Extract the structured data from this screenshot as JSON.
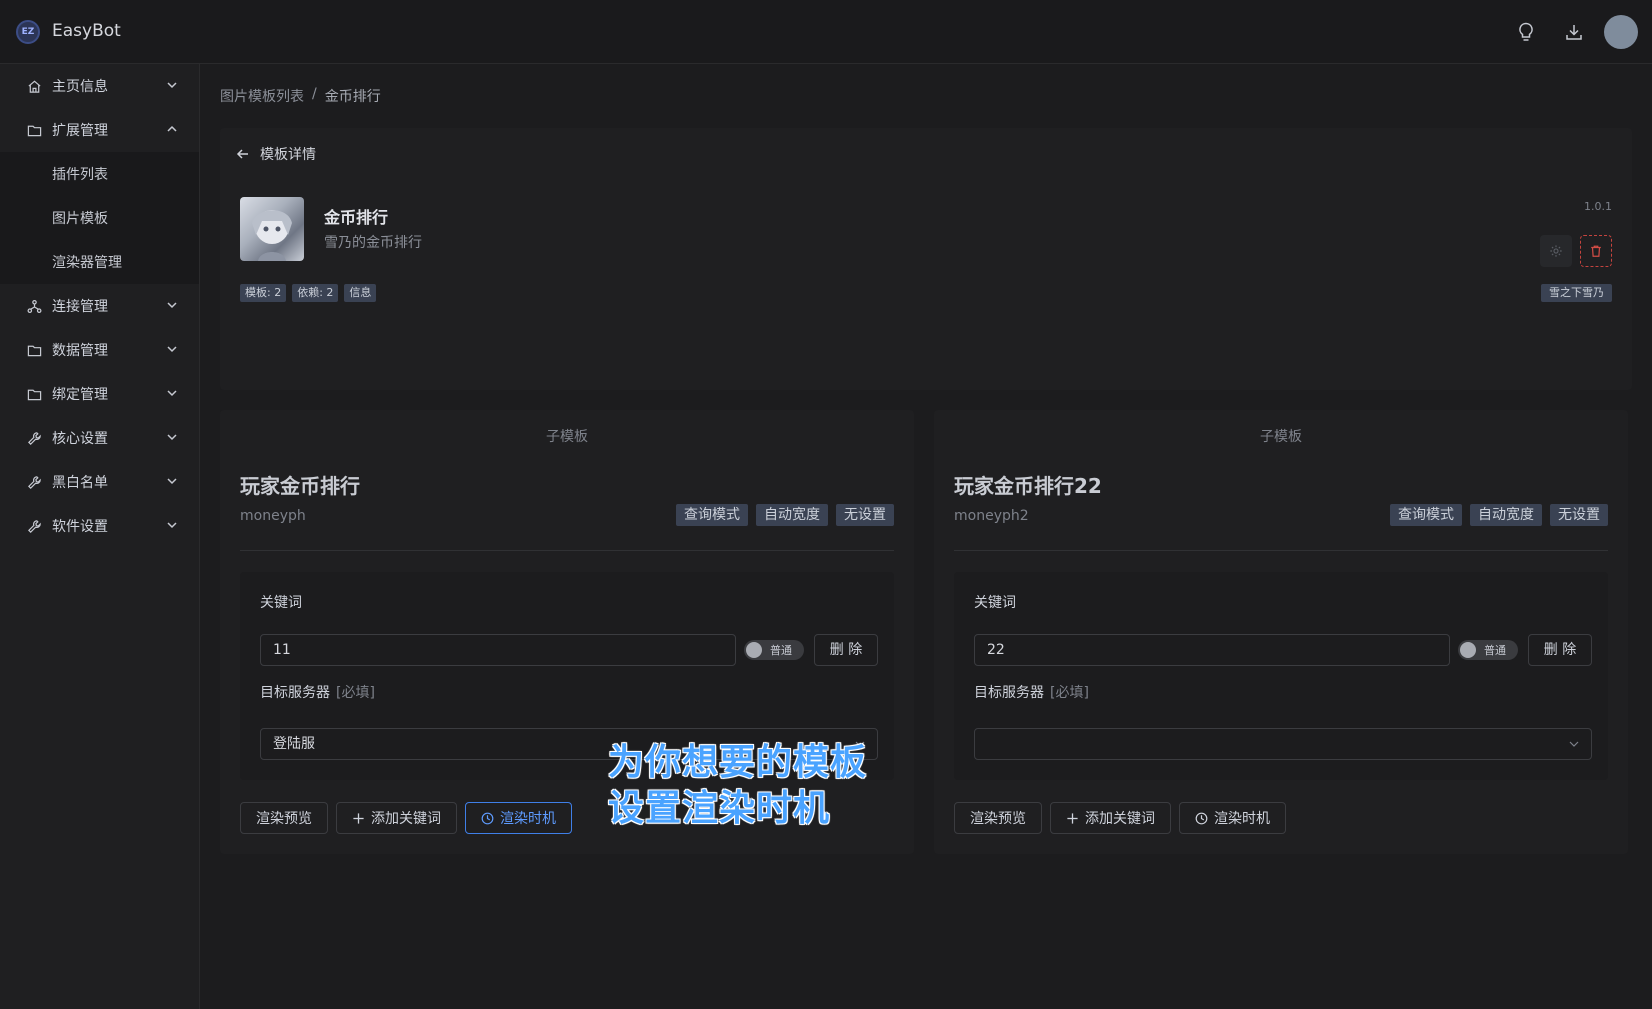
{
  "app": {
    "logo_text": "EZ",
    "title": "EasyBot"
  },
  "topbar": {
    "icons": [
      "lightbulb-icon",
      "download-icon"
    ]
  },
  "sidebar": {
    "items": [
      {
        "label": "主页信息",
        "icon": "home-icon"
      },
      {
        "label": "扩展管理",
        "icon": "folder-icon",
        "expanded": true,
        "children": [
          {
            "label": "插件列表"
          },
          {
            "label": "图片模板"
          },
          {
            "label": "渲染器管理"
          }
        ]
      },
      {
        "label": "连接管理",
        "icon": "network-icon"
      },
      {
        "label": "数据管理",
        "icon": "folder-icon"
      },
      {
        "label": "绑定管理",
        "icon": "folder-icon"
      },
      {
        "label": "核心设置",
        "icon": "wrench-icon"
      },
      {
        "label": "黑白名单",
        "icon": "wrench-icon"
      },
      {
        "label": "软件设置",
        "icon": "wrench-icon"
      }
    ]
  },
  "breadcrumb": {
    "parent": "图片模板列表",
    "separator": "/",
    "current": "金币排行"
  },
  "detail": {
    "back_label": "模板详情",
    "name": "金币排行",
    "description": "雪乃的金币排行",
    "version": "1.0.1",
    "tags": [
      "模板: 2",
      "依赖: 2",
      "信息"
    ],
    "author": "雪之下雪乃"
  },
  "subtemplates": [
    {
      "section_title": "子模板",
      "name": "玩家金币排行",
      "key": "moneyph",
      "tags": [
        "查询模式",
        "自动宽度",
        "无设置"
      ],
      "keyword_label": "关键词",
      "keyword_value": "11",
      "toggle_label": "普通",
      "delete_label": "删 除",
      "server_label": "目标服务器",
      "server_required": "[必填]",
      "server_value": "登陆服",
      "actions": {
        "preview": "渲染预览",
        "add_keyword": "添加关键词",
        "timing": "渲染时机"
      }
    },
    {
      "section_title": "子模板",
      "name": "玩家金币排行22",
      "key": "moneyph2",
      "tags": [
        "查询模式",
        "自动宽度",
        "无设置"
      ],
      "keyword_label": "关键词",
      "keyword_value": "22",
      "toggle_label": "普通",
      "delete_label": "删 除",
      "server_label": "目标服务器",
      "server_required": "[必填]",
      "server_value": "",
      "actions": {
        "preview": "渲染预览",
        "add_keyword": "添加关键词",
        "timing": "渲染时机"
      }
    }
  ],
  "overlay": {
    "line1": "为你想要的模板",
    "line2": "设置渲染时机"
  },
  "colors": {
    "accent": "#3f7fe8",
    "danger": "#c4433e",
    "tag_bg": "#3a4253",
    "overlay_text": "#4aa3ff"
  }
}
